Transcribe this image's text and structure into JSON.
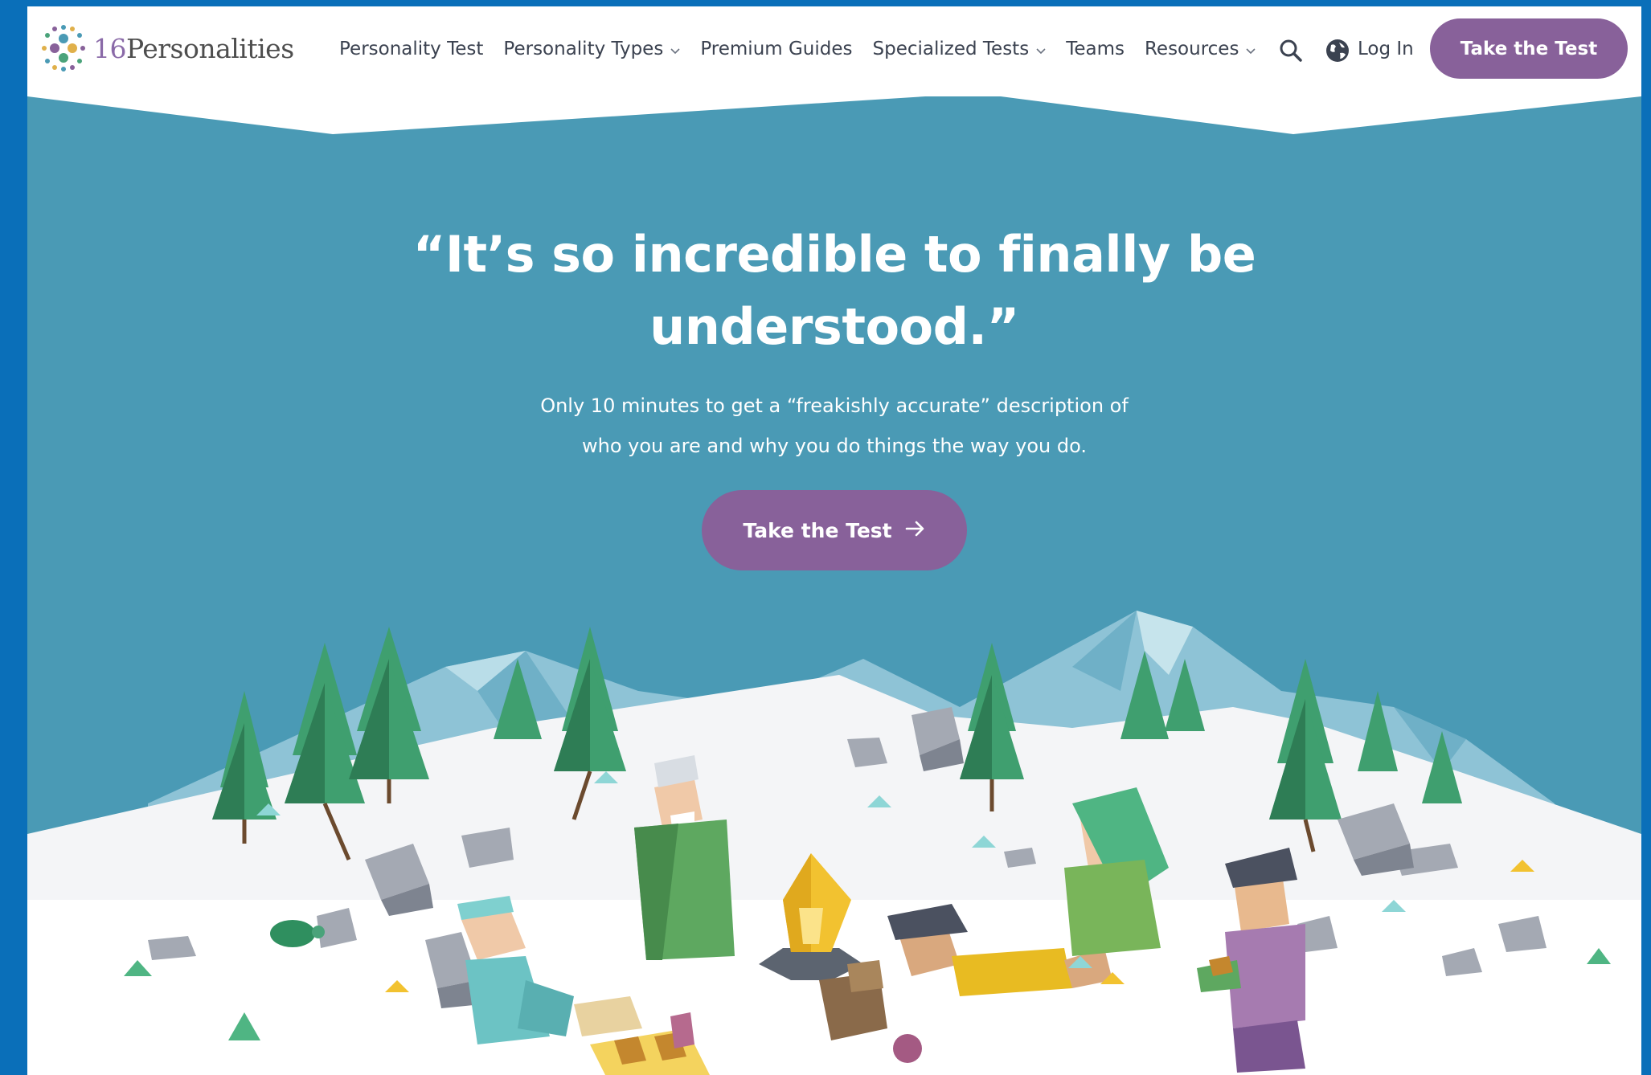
{
  "brand": {
    "name_num": "16",
    "name_text": "Personalities",
    "colors": {
      "purple": "#88619a",
      "hero_blue": "#4a9ab5",
      "frame_blue": "#0a6fb9"
    }
  },
  "nav": {
    "items": [
      {
        "label": "Personality Test",
        "has_menu": false
      },
      {
        "label": "Personality Types",
        "has_menu": true
      },
      {
        "label": "Premium Guides",
        "has_menu": false
      },
      {
        "label": "Specialized Tests",
        "has_menu": true
      },
      {
        "label": "Teams",
        "has_menu": false
      },
      {
        "label": "Resources",
        "has_menu": true
      }
    ],
    "icons": [
      "search-icon",
      "globe-icon"
    ],
    "login_label": "Log In",
    "cta_label": "Take the Test"
  },
  "hero": {
    "headline_line1": "“It’s so incredible to finally be",
    "headline_line2": "understood.”",
    "sub_line1": "Only 10 minutes to get a “freakishly accurate” description of",
    "sub_line2": "who you are and why you do things the way you do.",
    "cta_label": "Take the Test",
    "cta_icon": "arrow-right-icon"
  }
}
